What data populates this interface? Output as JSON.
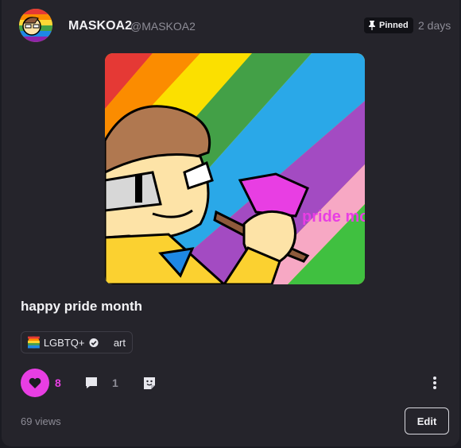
{
  "post": {
    "author_name": "MASKOA2",
    "author_handle": "@MASKOA2",
    "pinned_label": "Pinned",
    "time_ago": "2 days",
    "caption": "happy pride month",
    "artwork_text": "pride month",
    "tags": [
      "LGBTQ+",
      "art"
    ],
    "like_count": "8",
    "comment_count": "1",
    "views": "69 views",
    "edit_label": "Edit"
  },
  "icons": {
    "pin": "pin-icon",
    "like": "heart-icon",
    "comment": "comment-icon",
    "react": "emoji-react-icon",
    "more": "more-vertical-icon",
    "verified": "verified-icon"
  },
  "colors": {
    "background": "#25242b",
    "accent": "#e83ee3",
    "muted": "#8d8c96"
  }
}
